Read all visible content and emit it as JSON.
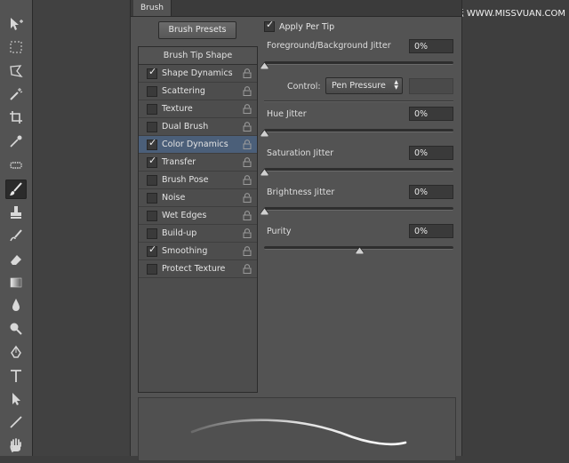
{
  "panel": {
    "tab_label": "Brush",
    "brush_presets_label": "Brush Presets",
    "list_header": "Brush Tip Shape",
    "items": [
      {
        "label": "Shape Dynamics",
        "checked": true,
        "selected": false
      },
      {
        "label": "Scattering",
        "checked": false,
        "selected": false
      },
      {
        "label": "Texture",
        "checked": false,
        "selected": false
      },
      {
        "label": "Dual Brush",
        "checked": false,
        "selected": false
      },
      {
        "label": "Color Dynamics",
        "checked": true,
        "selected": true
      },
      {
        "label": "Transfer",
        "checked": true,
        "selected": false
      },
      {
        "label": "Brush Pose",
        "checked": false,
        "selected": false
      },
      {
        "label": "Noise",
        "checked": false,
        "selected": false
      },
      {
        "label": "Wet Edges",
        "checked": false,
        "selected": false
      },
      {
        "label": "Build-up",
        "checked": false,
        "selected": false
      },
      {
        "label": "Smoothing",
        "checked": true,
        "selected": false
      },
      {
        "label": "Protect Texture",
        "checked": false,
        "selected": false
      }
    ]
  },
  "settings": {
    "apply_per_tip_label": "Apply Per Tip",
    "apply_per_tip_checked": true,
    "fg_bg_jitter": {
      "label": "Foreground/Background Jitter",
      "value": "0%",
      "level": 0
    },
    "control_label": "Control:",
    "control_value": "Pen Pressure",
    "hue_jitter": {
      "label": "Hue Jitter",
      "value": "0%",
      "level": 0
    },
    "saturation_jitter": {
      "label": "Saturation Jitter",
      "value": "0%",
      "level": 0
    },
    "brightness_jitter": {
      "label": "Brightness Jitter",
      "value": "0%",
      "level": 0
    },
    "purity": {
      "label": "Purity",
      "value": "0%",
      "level": 0.5
    }
  },
  "watermark": "思缘设计论坛 WWW.MISSVUAN.COM",
  "colors": {
    "selection": "#4b5f79",
    "panel": "#535353",
    "background": "#3e3e3e"
  }
}
